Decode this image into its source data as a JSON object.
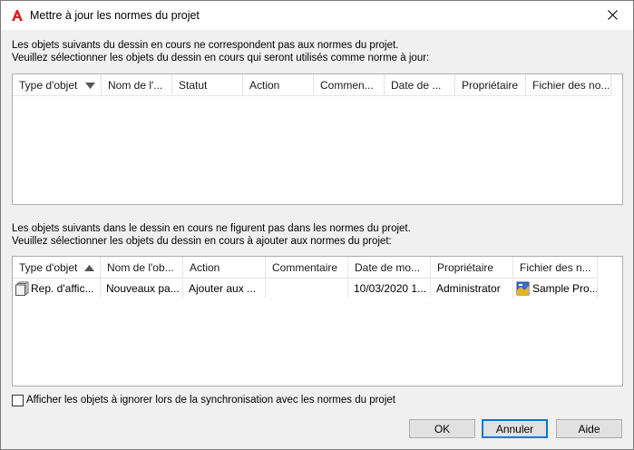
{
  "window": {
    "title": "Mettre à jour les normes du projet",
    "close_glyph": "✕",
    "app_icon": "autocad-logo-icon",
    "accent_color": "#e01e1e"
  },
  "section1": {
    "line1": "Les objets suivants du dessin en cours ne correspondent pas aux normes du projet.",
    "line2": "Veuillez sélectionner les objets du dessin en cours qui seront utilisés comme norme à jour:",
    "columns": [
      "Type d'objet",
      "Nom de l'...",
      "Statut",
      "Action",
      "Commen...",
      "Date de ...",
      "Propriétaire",
      "Fichier des no..."
    ],
    "sort_column": "Type d'objet",
    "sort_direction": "descending",
    "rows": []
  },
  "section2": {
    "line1": "Les objets suivants dans le dessin en cours ne figurent pas dans les normes du projet.",
    "line2": "Veuillez sélectionner les objets du dessin en cours à ajouter aux normes du projet:",
    "columns": [
      "Type d'objet",
      "Nom de l'ob...",
      "Action",
      "Commentaire",
      "Date de mo...",
      "Propriétaire",
      "Fichier des n..."
    ],
    "sort_column": "Type d'objet",
    "sort_direction": "ascending",
    "rows": [
      {
        "type": "Rep. d'affic...",
        "type_icon": "layer-state-icon",
        "name": "Nouveaux pa...",
        "action": "Ajouter aux ...",
        "comment": "",
        "date": "10/03/2020 1...",
        "owner": "Administrator",
        "file": "Sample Pro...",
        "file_icon": "standards-file-icon"
      }
    ]
  },
  "checkbox": {
    "label": "Afficher les objets à ignorer lors de la synchronisation avec les normes du projet",
    "checked": false
  },
  "buttons": {
    "ok": "OK",
    "cancel": "Annuler",
    "help": "Aide"
  }
}
